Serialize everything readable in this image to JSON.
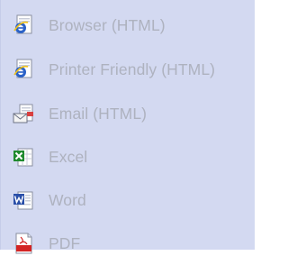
{
  "export_menu": {
    "items": [
      {
        "label": "Browser (HTML)",
        "icon": "ie-browser-icon"
      },
      {
        "label": "Printer Friendly (HTML)",
        "icon": "ie-printer-icon"
      },
      {
        "label": "Email (HTML)",
        "icon": "email-icon"
      },
      {
        "label": "Excel",
        "icon": "excel-icon"
      },
      {
        "label": "Word",
        "icon": "word-icon"
      },
      {
        "label": "PDF",
        "icon": "pdf-icon"
      }
    ]
  },
  "colors": {
    "panel_background": "#d3d9f1",
    "label_text": "#aeb2bf",
    "ie_blue": "#2b62c8",
    "excel_green": "#1f8a2e",
    "word_blue": "#2a4fa8",
    "pdf_red": "#d32424"
  }
}
